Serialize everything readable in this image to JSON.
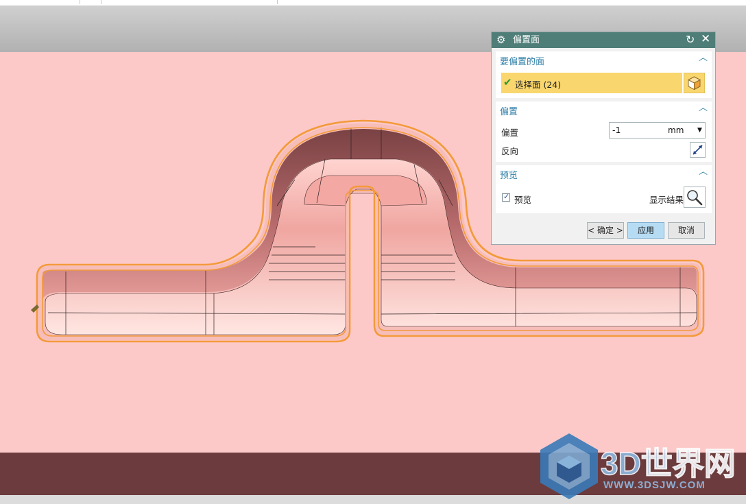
{
  "dialog": {
    "title": "偏置面",
    "faces_group": {
      "header": "要偏置的面",
      "select_label": "选择面 (24)"
    },
    "offset_group": {
      "header": "偏置",
      "offset_label": "偏置",
      "offset_value": "-1",
      "offset_unit": "mm",
      "reverse_label": "反向"
    },
    "preview_group": {
      "header": "预览",
      "preview_label": "预览",
      "preview_checked": true,
      "show_result_label": "显示结果"
    },
    "buttons": {
      "ok": "< 确定 >",
      "apply": "应用",
      "cancel": "取消"
    }
  },
  "watermark": {
    "brand": "3D世界网",
    "url": "WWW.3DSJW.COM"
  },
  "colors": {
    "title_bar": "#4f7e79",
    "selection_highlight": "#f9d66e",
    "group_header": "#2f7fa8",
    "apply_button": "#b6dcf4",
    "part_surface": "#fcc9c8",
    "part_side": "#6b3b3d",
    "face_edges": "#f39a3a"
  },
  "icons": {
    "title": "gear-icon",
    "reset": "reset-icon",
    "close": "close-icon",
    "check": "check-icon",
    "face_selector": "face-cube-icon",
    "reverse": "reverse-direction-icon",
    "show_result": "magnifier-icon"
  }
}
